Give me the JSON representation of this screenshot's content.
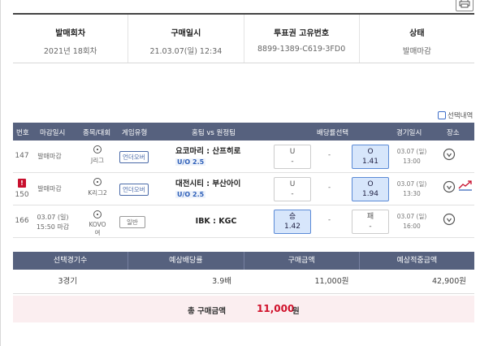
{
  "info": {
    "headers": [
      "발매회차",
      "구매일시",
      "투표권 고유번호",
      "상태"
    ],
    "values": [
      "2021년 18회차",
      "21.03.07(일) 12:34",
      "8899-1389-C619-3FD0",
      "발매마감"
    ]
  },
  "select_checkbox_label": "선택내역",
  "games_table": {
    "headers": [
      "번호",
      "마감일시",
      "종목/대회",
      "게임유형",
      "홈팀 vs 원정팀",
      "배당률선택",
      "경기일시",
      "장소"
    ],
    "rows": [
      {
        "num": "147",
        "close": "발매마감",
        "league": "J리그",
        "game_type": "언더오버",
        "teams": "요코마리 : 산프히로",
        "sub": "U/O 2.5",
        "odd1_label": "U",
        "odd1_value": "-",
        "middle": "-",
        "odd3_label": "O",
        "odd3_value": "1.41",
        "date": "03.07 (일)",
        "time": "13:00",
        "selected": "odd3"
      },
      {
        "num": "150",
        "close": "발매마감",
        "league": "K리그2",
        "game_type": "언더오버",
        "teams": "대전시티 : 부산아이",
        "sub": "U/O 2.5",
        "odd1_label": "U",
        "odd1_value": "-",
        "middle": "-",
        "odd3_label": "O",
        "odd3_value": "1.94",
        "date": "03.07 (일)",
        "time": "13:30",
        "selected": "odd3",
        "warning": "!"
      },
      {
        "num": "166",
        "close_date": "03.07 (일)",
        "close_time": "15:50 마감",
        "league": "KOVO여",
        "game_type": "일반",
        "teams": "IBK : KGC",
        "odd1_label": "승",
        "odd1_value": "1.42",
        "middle": "-",
        "odd3_label": "패",
        "odd3_value": "-",
        "date": "03.07 (일)",
        "time": "16:00",
        "selected": "odd1"
      }
    ]
  },
  "summary": {
    "headers": [
      "선택경기수",
      "예상배당률",
      "구매금액",
      "예상적중금액"
    ],
    "values": [
      "3경기",
      "3.9배",
      "11,000원",
      "42,900원"
    ],
    "total_label": "총 구매금액",
    "total_amount": "11,000",
    "total_unit": "원"
  }
}
